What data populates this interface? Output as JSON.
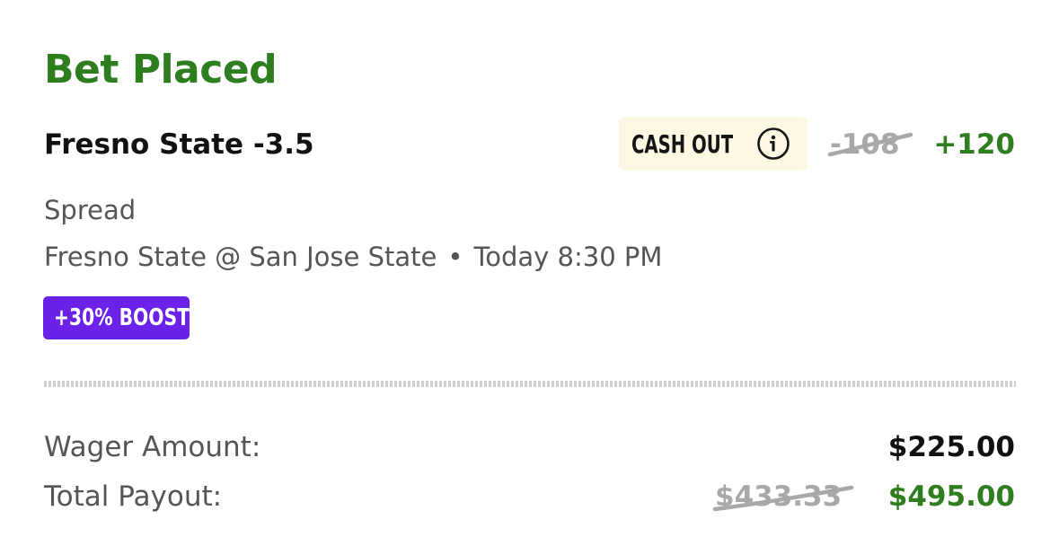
{
  "header": {
    "title": "Bet Placed"
  },
  "bet": {
    "selection": "Fresno State -3.5",
    "cash_out_label": "CASH OUT",
    "odds_original": "-108",
    "odds_boosted": "+120",
    "market": "Spread",
    "matchup": "Fresno State @ San Jose State",
    "separator": "•",
    "time": "Today 8:30 PM",
    "boost_label": "+30% BOOST"
  },
  "summary": {
    "wager_label": "Wager Amount:",
    "wager_value": "$225.00",
    "payout_label": "Total Payout:",
    "payout_original": "$433.33",
    "payout_boosted": "$495.00"
  },
  "icons": {
    "info": "info-circle-icon"
  },
  "colors": {
    "brand_green": "#2e7d1e",
    "boost_purple": "#6b21e8",
    "cashout_bg": "#fdf8e3",
    "muted_text": "#555555",
    "strike_gray": "#a8a8a8"
  }
}
